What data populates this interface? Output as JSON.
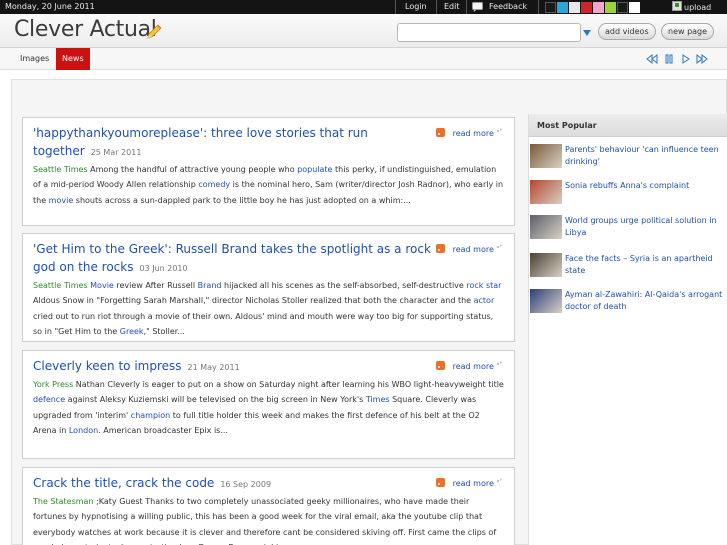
{
  "topbar": {
    "date": "Monday, 20 June 2011",
    "login": "Login",
    "edit": "Edit",
    "feedback": "Feedback",
    "upload": "upload",
    "swatch_colors": [
      "#1a1a1a",
      "#2aa7d6",
      "#e8e8e8",
      "#d2232a",
      "#f3a6c9",
      "#9ad33a",
      "#1a1a1a",
      "#ffffff"
    ]
  },
  "header": {
    "site_name": "Clever Actual",
    "search_value": "",
    "add_videos": "add videos",
    "new_page": "new page"
  },
  "tabs": [
    {
      "label": "Images",
      "active": false
    },
    {
      "label": "News",
      "active": true
    }
  ],
  "news": [
    {
      "title": "'happythankyoumoreplease': three love stories that run together",
      "date": "25 Mar 2011",
      "more": "read more",
      "segments": [
        {
          "t": "Seattle Times",
          "k": "src"
        },
        {
          "t": "  Among the handful of attractive young people who ",
          "k": ""
        },
        {
          "t": "populate",
          "k": "kw"
        },
        {
          "t": " this perky, if undistinguished, emulation of a mid-period Woody Allen relationship ",
          "k": ""
        },
        {
          "t": "comedy",
          "k": "kw"
        },
        {
          "t": " is the nominal hero, Sam (writer/director Josh Radnor), who early in the ",
          "k": ""
        },
        {
          "t": "movie",
          "k": "kw"
        },
        {
          "t": " shouts across a sun-dappled park to the little boy he has just adopted on a whim:...",
          "k": ""
        }
      ]
    },
    {
      "title": "'Get Him to the Greek': Russell Brand takes the spotlight as a rock god on the rocks",
      "date": "03 Jun 2010",
      "more": "read more",
      "segments": [
        {
          "t": "Seattle Times",
          "k": "src"
        },
        {
          "t": "  ",
          "k": ""
        },
        {
          "t": "Movie",
          "k": "kw"
        },
        {
          "t": " review After Russell ",
          "k": ""
        },
        {
          "t": "Brand",
          "k": "kw"
        },
        {
          "t": " hijacked all his scenes as the self-absorbed, self-destructive ",
          "k": ""
        },
        {
          "t": "rock star",
          "k": "kw"
        },
        {
          "t": " Aldous Snow in \"Forgetting Sarah Marshall,\" director Nicholas Stoller realized that both the character and the ",
          "k": ""
        },
        {
          "t": "actor",
          "k": "kw"
        },
        {
          "t": " cried out to run riot through a movie of their own. Aldous' mind and mouth were way too big for supporting status, so in \"Get Him to the ",
          "k": ""
        },
        {
          "t": "Greek",
          "k": "kw"
        },
        {
          "t": ",\" Stoller...",
          "k": ""
        }
      ]
    },
    {
      "title": "Cleverly keen to impress",
      "date": "21 May 2011",
      "more": "read more",
      "segments": [
        {
          "t": "York Press",
          "k": "src"
        },
        {
          "t": "  Nathan Cleverly is eager to put on a show on Saturday night after learning his WBO light-heavyweight title ",
          "k": ""
        },
        {
          "t": "defence",
          "k": "kw"
        },
        {
          "t": " against Aleksy Kuziemski will be televised on the big screen in New York's ",
          "k": ""
        },
        {
          "t": "Times",
          "k": "kw"
        },
        {
          "t": " Square. Cleverly was upgraded from 'interim' ",
          "k": ""
        },
        {
          "t": "champion",
          "k": "kw"
        },
        {
          "t": " to full title holder this week and makes the first defence of his belt at the O2 Arena in ",
          "k": ""
        },
        {
          "t": "London",
          "k": "kw"
        },
        {
          "t": ". American broadcaster Epix is...",
          "k": ""
        }
      ]
    },
    {
      "title": "Crack the title, crack the code",
      "date": "16 Sep 2009",
      "more": "read more",
      "segments": [
        {
          "t": "The Statesman",
          "k": "src"
        },
        {
          "t": "  ;Katy Guest Thanks to two completely unassociated geeky millionaires, who have made their fortunes by hypnotising a willing public, this has been a good week for the viral email, aka the youtube clip that everybody watches at work because it is clever and therefore cant be considered skiving off. First came the clips of psychology ",
          "k": ""
        },
        {
          "t": "students",
          "k": "kw"
        },
        {
          "t": " demonstrating how Derren Brown might...",
          "k": ""
        }
      ]
    }
  ],
  "sidebar": {
    "heading": "Most Popular",
    "items": [
      {
        "label": "Parents' behaviour 'can influence teen drinking'",
        "thumb": "#7a5a3a"
      },
      {
        "label": "Sonia rebuffs Anna's complaint",
        "thumb": "#b6452e"
      },
      {
        "label": "World groups urge political solution in Libya",
        "thumb": "#5b5f6a"
      },
      {
        "label": "Face the facts – Syria is an apartheid state",
        "thumb": "#4a4034"
      },
      {
        "label": "Ayman al-Zawahiri: Al-Qaida's arrogant doctor of death",
        "thumb": "#2b3f7a"
      }
    ]
  }
}
